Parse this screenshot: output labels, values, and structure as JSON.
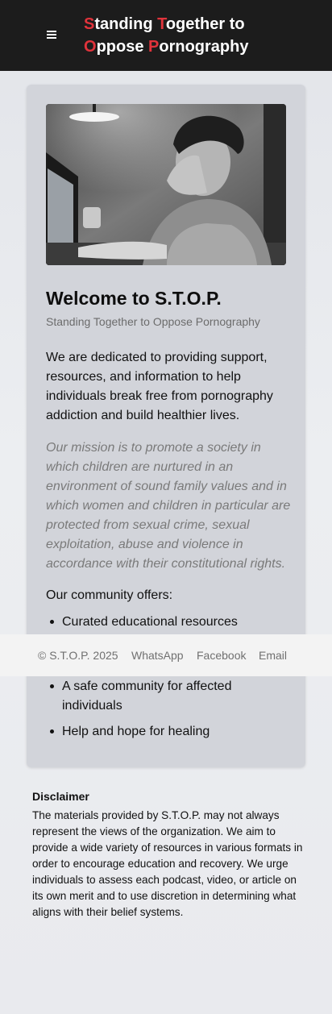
{
  "header": {
    "menu_icon": "hamburger-menu-icon",
    "brand_line1": [
      {
        "text": "S",
        "accent": true
      },
      {
        "text": "tanding ",
        "accent": false
      },
      {
        "text": "T",
        "accent": true
      },
      {
        "text": "ogether to",
        "accent": false
      }
    ],
    "brand_line2": [
      {
        "text": "O",
        "accent": true
      },
      {
        "text": "ppose ",
        "accent": false
      },
      {
        "text": "P",
        "accent": true
      },
      {
        "text": "ornography",
        "accent": false
      }
    ],
    "accent_color": "#e1333b",
    "background_color": "#1c1c1c"
  },
  "card": {
    "title": "Welcome to S.T.O.P.",
    "subtitle": "Standing Together to Oppose Pornography",
    "intro": "We are dedicated to providing support, resources, and information to help individuals break free from pornography addiction and build healthier lives.",
    "mission": "Our mission is to promote a society in which children are nurtured in an environment of sound family values and in which women and children in particular are protected from sexual crime, sexual exploitation, abuse and violence in accordance with their constitutional rights.",
    "offers_heading": "Our community offers:",
    "offers": [
      "Curated educational resources",
      "A safe community for affected individuals",
      "Help and hope for healing"
    ]
  },
  "footer": {
    "copyright": "© S.T.O.P. 2025",
    "links": [
      "WhatsApp",
      "Facebook",
      "Email"
    ]
  },
  "disclaimer": {
    "title": "Disclaimer",
    "text": "The materials provided by S.T.O.P. may not always represent the views of the organization. We aim to provide a wide variety of resources in various formats in order to encourage education and recovery. We urge individuals to assess each podcast, video, or article on its own merit and to use discretion in determining what aligns with their belief systems."
  }
}
